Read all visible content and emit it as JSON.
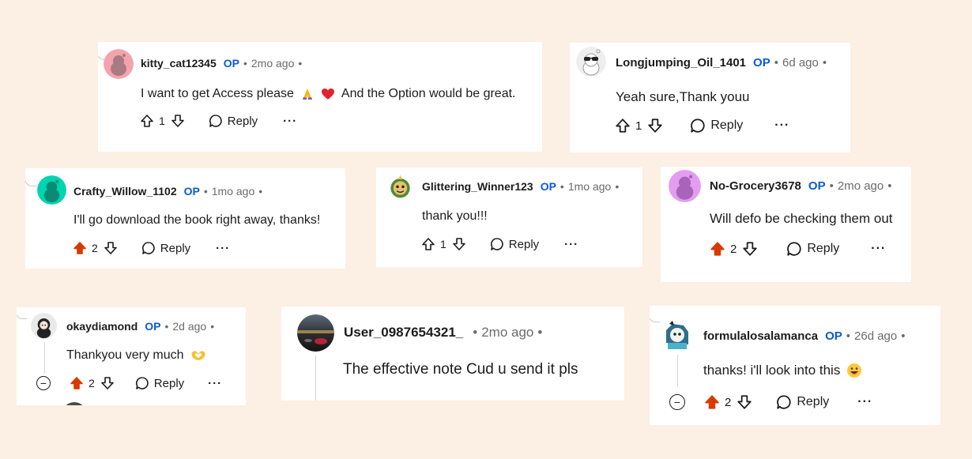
{
  "comments": [
    {
      "username": "kitty_cat12345",
      "op": "OP",
      "time": "2mo ago",
      "text_before": "I want to get Access please",
      "text_after": "And the Option would be great.",
      "score": "1",
      "reply": "Reply",
      "more": "···",
      "upvoted": false
    },
    {
      "username": "Longjumping_Oil_1401",
      "op": "OP",
      "time": "6d ago",
      "text": "Yeah sure,Thank youu",
      "score": "1",
      "reply": "Reply",
      "more": "···",
      "upvoted": false
    },
    {
      "username": "Crafty_Willow_1102",
      "op": "OP",
      "time": "1mo ago",
      "text": "I'll go download the book right away, thanks!",
      "score": "2",
      "reply": "Reply",
      "more": "···",
      "upvoted": true
    },
    {
      "username": "Glittering_Winner123",
      "op": "OP",
      "time": "1mo ago",
      "text": "thank you!!!",
      "score": "1",
      "reply": "Reply",
      "more": "···",
      "upvoted": false
    },
    {
      "username": "No-Grocery3678",
      "op": "OP",
      "time": "2mo ago",
      "text": "Will defo be checking them out",
      "score": "2",
      "reply": "Reply",
      "more": "···",
      "upvoted": true
    },
    {
      "username": "okaydiamond",
      "op": "OP",
      "time": "2d ago",
      "text": "Thankyou very much",
      "score": "2",
      "reply": "Reply",
      "more": "···",
      "upvoted": true,
      "collapse": "−"
    },
    {
      "username": "User_0987654321_",
      "time": "2mo ago",
      "text": "The effective note Cud u send it pls"
    },
    {
      "username": "formulalosalamanca",
      "op": "OP",
      "time": "26d ago",
      "text": "thanks! i'll look into this",
      "score": "2",
      "reply": "Reply",
      "more": "···",
      "upvoted": true,
      "collapse": "−"
    }
  ],
  "colors": {
    "background": "#fcefe3",
    "op": "#0a5ad4",
    "upvote_active": "#d93900",
    "meta": "#6b6b6b"
  },
  "dot": "•"
}
